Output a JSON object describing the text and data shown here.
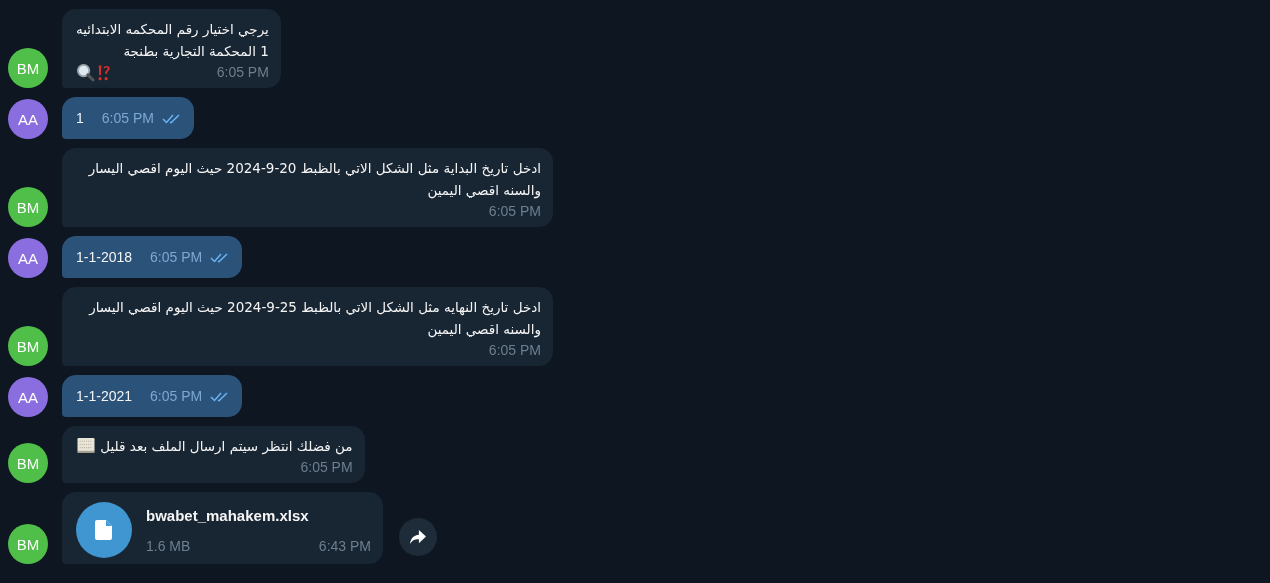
{
  "messages": [
    {
      "kind": "text",
      "outgoing": false,
      "avatar": {
        "initials": "BM",
        "color": "#4fbf4a"
      },
      "lines": [
        "يرجي اختيار رقم المحكمه الابتدائيه",
        "1 المحكمة التجارية بطنجة"
      ],
      "emoji": [
        {
          "kind": "magnifier"
        },
        {
          "kind": "exclamation-question"
        }
      ],
      "time": "6:05 PM"
    },
    {
      "kind": "text",
      "outgoing": true,
      "avatar": {
        "initials": "AA",
        "color": "#8a6ee0"
      },
      "lines": [
        "1"
      ],
      "time": "6:05 PM",
      "read": true
    },
    {
      "kind": "text",
      "outgoing": false,
      "avatar": {
        "initials": "BM",
        "color": "#4fbf4a"
      },
      "lines": [
        "ادخل تاريخ البداية مثل الشكل الاتي بالظبط 20-9-2024 حيث اليوم اقصي اليسار والسنه اقصي اليمين"
      ],
      "time": "6:05 PM"
    },
    {
      "kind": "text",
      "outgoing": true,
      "avatar": {
        "initials": "AA",
        "color": "#8a6ee0"
      },
      "lines": [
        "1-1-2018"
      ],
      "time": "6:05 PM",
      "read": true
    },
    {
      "kind": "text",
      "outgoing": false,
      "avatar": {
        "initials": "BM",
        "color": "#4fbf4a"
      },
      "lines": [
        "ادخل تاريخ النهايه مثل الشكل الاتي بالظبط 25-9-2024 حيث اليوم اقصي اليسار والسنه اقصي اليمين"
      ],
      "time": "6:05 PM"
    },
    {
      "kind": "text",
      "outgoing": true,
      "avatar": {
        "initials": "AA",
        "color": "#8a6ee0"
      },
      "lines": [
        "1-1-2021"
      ],
      "time": "6:05 PM",
      "read": true
    },
    {
      "kind": "text",
      "outgoing": false,
      "avatar": {
        "initials": "BM",
        "color": "#4fbf4a"
      },
      "lines": [
        "من فضلك انتظر سيتم ارسال الملف بعد قليل"
      ],
      "inline_emoji": [
        {
          "kind": "page"
        }
      ],
      "time": "6:05 PM"
    },
    {
      "kind": "file",
      "outgoing": false,
      "avatar": {
        "initials": "BM",
        "color": "#4fbf4a"
      },
      "file_name": "bwabet_mahakem.xlsx",
      "size": "1.6 MB",
      "time": "6:43 PM",
      "forward": true
    }
  ]
}
